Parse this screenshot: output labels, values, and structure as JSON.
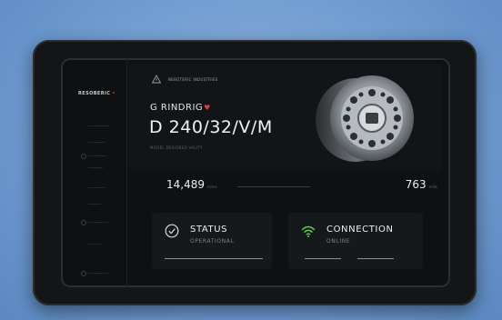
{
  "sidebar": {
    "brand": "RESOBERIC",
    "items": [
      "",
      "",
      "",
      "",
      "",
      "",
      "",
      ""
    ]
  },
  "hero": {
    "top_label": "NEBOTERIC INDUSTRIES",
    "product_name": "G RINDRIG",
    "product_code": "D 240/32/V/M",
    "product_sub": "MODEL DESIGNED VALITY"
  },
  "metrics": {
    "left_value": "14,489",
    "left_unit": "miles",
    "right_value": "763",
    "right_unit": "mills"
  },
  "status": {
    "title": "STATUS",
    "value": "OPERATIONAL"
  },
  "connection": {
    "title": "CONNECTION",
    "value": "ONLINE"
  },
  "colors": {
    "accent_red": "#e0343b",
    "accent_green": "#5fd14a",
    "background_blue": "#6f9bd0",
    "device_dark": "#141517"
  },
  "icons": {
    "status": "check-circle-icon",
    "connection": "wifi-icon",
    "brand": "triangle-warning-icon"
  }
}
